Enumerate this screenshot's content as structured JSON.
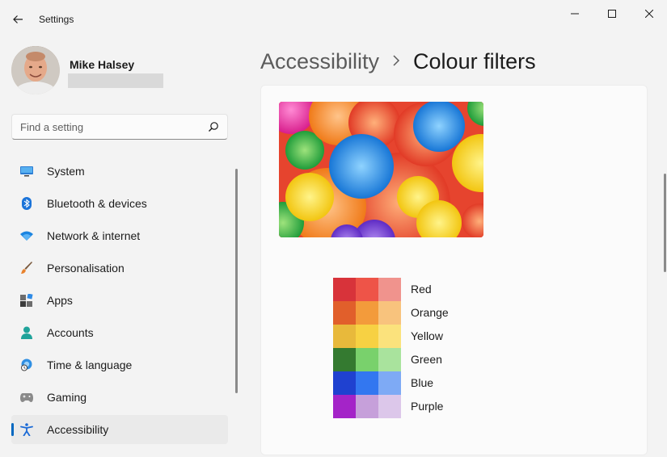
{
  "app": {
    "title": "Settings"
  },
  "user": {
    "name": "Mike Halsey"
  },
  "search": {
    "placeholder": "Find a setting"
  },
  "nav": {
    "items": [
      {
        "label": "System",
        "icon": "monitor-icon"
      },
      {
        "label": "Bluetooth & devices",
        "icon": "bluetooth-icon"
      },
      {
        "label": "Network & internet",
        "icon": "wifi-icon"
      },
      {
        "label": "Personalisation",
        "icon": "brush-icon"
      },
      {
        "label": "Apps",
        "icon": "apps-icon"
      },
      {
        "label": "Accounts",
        "icon": "person-icon"
      },
      {
        "label": "Time & language",
        "icon": "globe-clock-icon"
      },
      {
        "label": "Gaming",
        "icon": "gamepad-icon"
      },
      {
        "label": "Accessibility",
        "icon": "accessibility-icon",
        "selected": true
      }
    ]
  },
  "breadcrumb": {
    "parent": "Accessibility",
    "current": "Colour filters"
  },
  "swatches": [
    {
      "label": "Red",
      "colors": [
        "#d8333a",
        "#ee5448",
        "#f0938d"
      ]
    },
    {
      "label": "Orange",
      "colors": [
        "#e15f2b",
        "#f39b3b",
        "#f8c37d"
      ]
    },
    {
      "label": "Yellow",
      "colors": [
        "#e8b93b",
        "#f7d143",
        "#fbe27c"
      ]
    },
    {
      "label": "Green",
      "colors": [
        "#347a30",
        "#79d16c",
        "#a9e39d"
      ]
    },
    {
      "label": "Blue",
      "colors": [
        "#1f41d0",
        "#3377f0",
        "#7eaaf5"
      ]
    },
    {
      "label": "Purple",
      "colors": [
        "#a424c8",
        "#c6a0da",
        "#dcc7ea"
      ]
    }
  ],
  "colors": {
    "accent": "#0067c0"
  }
}
